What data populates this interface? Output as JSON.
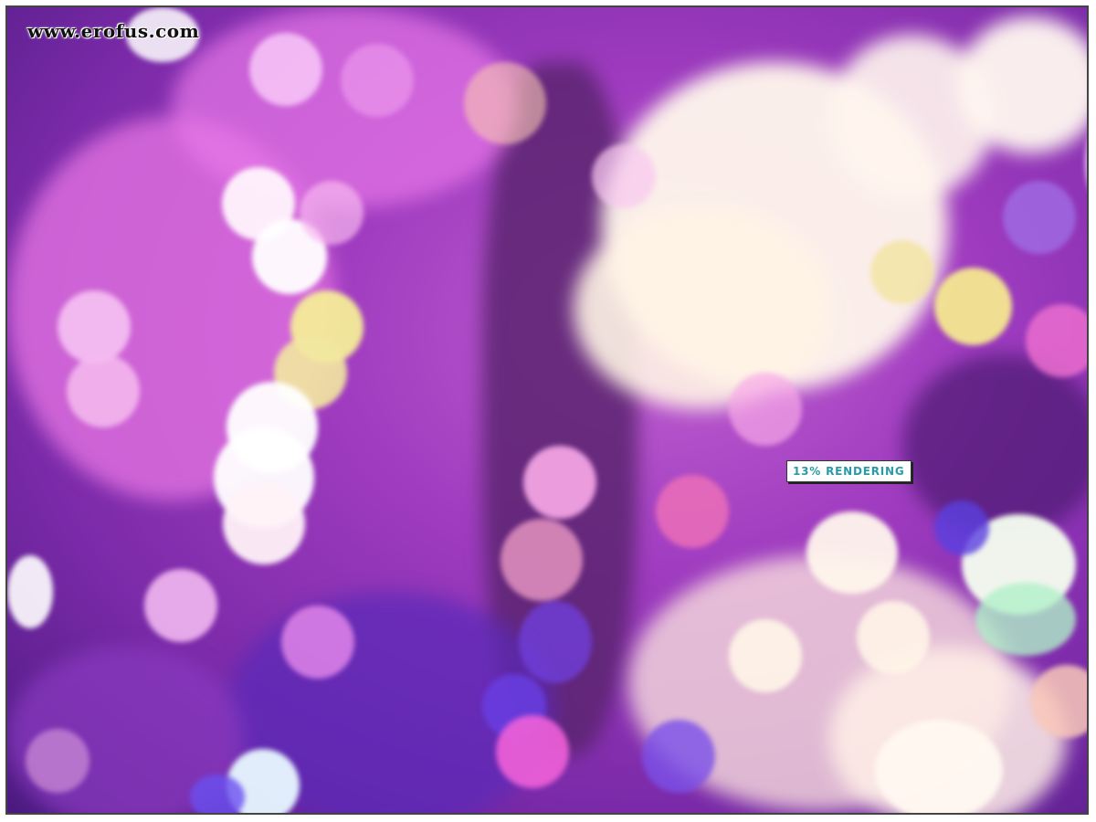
{
  "watermark": {
    "text": "www.erofus.com"
  },
  "overlay": {
    "status_text": "13% RENDERING"
  },
  "scene": {
    "description_colors": {
      "base": "#a03cc0",
      "highlight": "#fff6e0",
      "accent_yellow": "#f4e890",
      "accent_pink": "#f070c0",
      "accent_blue": "#5a3ad8"
    }
  }
}
